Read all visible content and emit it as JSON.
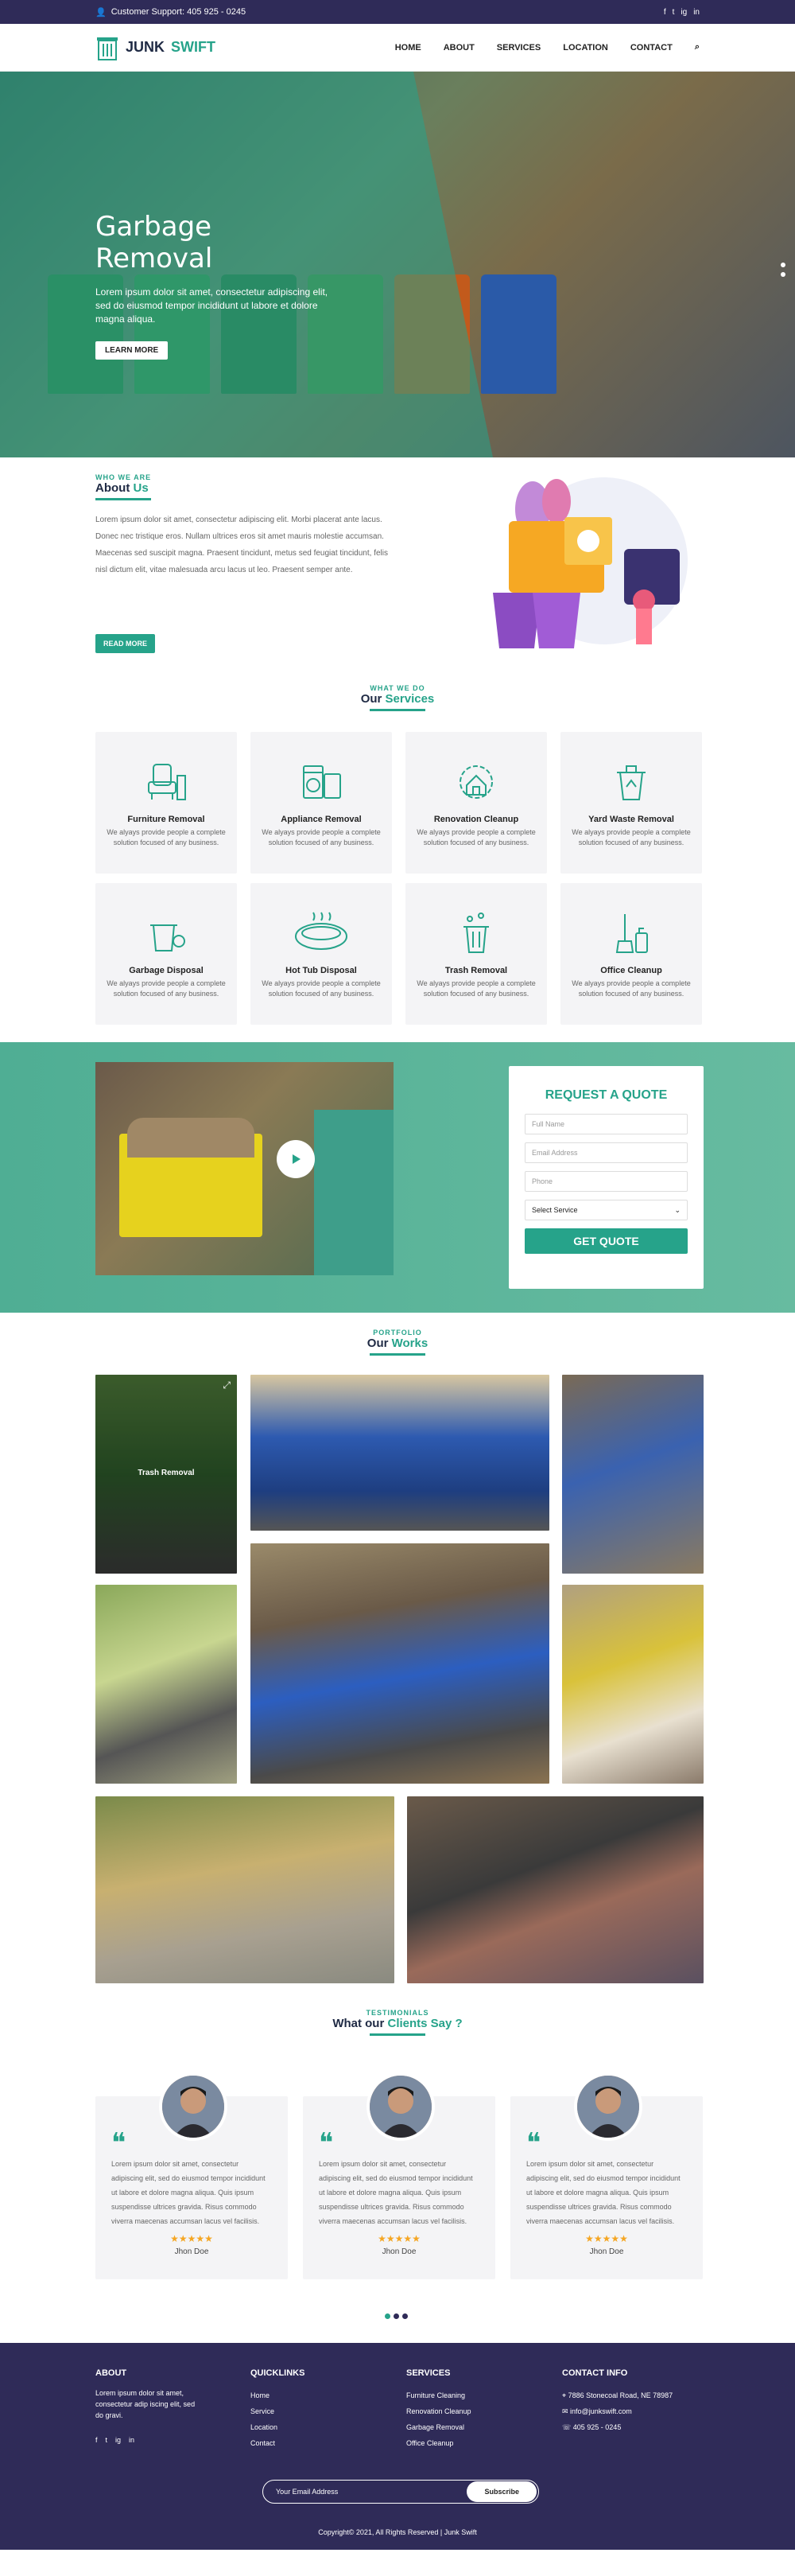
{
  "topbar": {
    "support": "Customer Support: 405 925 - 0245",
    "social": [
      "f",
      "t",
      "ig",
      "in"
    ]
  },
  "nav": {
    "brand_a": "JUNK",
    "brand_b": "SWIFT",
    "items": [
      "HOME",
      "ABOUT",
      "SERVICES",
      "LOCATION",
      "CONTACT"
    ]
  },
  "hero": {
    "title": "Garbage Removal",
    "text": "Lorem ipsum dolor sit amet, consectetur adipiscing elit, sed do eiusmod tempor incididunt ut labore et dolore magna aliqua.",
    "cta": "LEARN MORE"
  },
  "about": {
    "eyebrow": "WHO WE ARE",
    "title_a": "About",
    "title_b": "Us",
    "text": "Lorem ipsum dolor sit amet, consectetur adipiscing elit. Morbi placerat ante lacus. Donec nec tristique eros. Nullam ultrices eros sit amet mauris molestie accumsan. Maecenas sed suscipit magna. Praesent tincidunt, metus sed feugiat tincidunt, felis nisl dictum elit, vitae malesuada arcu lacus ut leo. Praesent semper ante.",
    "cta": "READ MORE"
  },
  "services": {
    "eyebrow": "WHAT WE DO",
    "title_a": "Our",
    "title_b": "Services",
    "items": [
      {
        "title": "Furniture Removal",
        "desc": "We alyays provide people a complete solution focused of any business.",
        "icon": "chair-icon"
      },
      {
        "title": "Appliance Removal",
        "desc": "We alyays provide people a complete solution focused of any business.",
        "icon": "washer-icon"
      },
      {
        "title": "Renovation Cleanup",
        "desc": "We alyays provide people a complete solution focused of any business.",
        "icon": "house-gear-icon"
      },
      {
        "title": "Yard Waste Removal",
        "desc": "We alyays provide people a complete solution focused of any business.",
        "icon": "recycle-bin-icon"
      },
      {
        "title": "Garbage Disposal",
        "desc": "We alyays provide people a complete solution focused of any business.",
        "icon": "garbage-bin-icon"
      },
      {
        "title": "Hot Tub Disposal",
        "desc": "We alyays provide people a complete solution focused of any business.",
        "icon": "hot-tub-icon"
      },
      {
        "title": "Trash Removal",
        "desc": "We alyays provide people a complete solution focused of any business.",
        "icon": "trash-can-icon"
      },
      {
        "title": "Office Cleanup",
        "desc": "We alyays provide people a complete solution focused of any business.",
        "icon": "cleaning-icon"
      }
    ]
  },
  "quote": {
    "title": "REQUEST A QUOTE",
    "fields": [
      "Full Name",
      "Email Address",
      "Phone"
    ],
    "select": "Select Service",
    "submit": "GET QUOTE"
  },
  "works": {
    "eyebrow": "PORTFOLIO",
    "title_a": "Our",
    "title_b": "Works",
    "caption": "Trash Removal"
  },
  "testimonials": {
    "eyebrow": "TESTIMONIALS",
    "title_a": "What our",
    "title_b": "Clients Say ?",
    "items": [
      {
        "text": "Lorem ipsum dolor sit amet, consectetur adipiscing elit, sed do eiusmod tempor incididunt ut labore et dolore magna aliqua. Quis ipsum suspendisse ultrices gravida. Risus commodo viverra maecenas accumsan lacus vel facilisis.",
        "name": "Jhon Doe",
        "stars": "★★★★★"
      },
      {
        "text": "Lorem ipsum dolor sit amet, consectetur adipiscing elit, sed do eiusmod tempor incididunt ut labore et dolore magna aliqua. Quis ipsum suspendisse ultrices gravida. Risus commodo viverra maecenas accumsan lacus vel facilisis.",
        "name": "Jhon Doe",
        "stars": "★★★★★"
      },
      {
        "text": "Lorem ipsum dolor sit amet, consectetur adipiscing elit, sed do eiusmod tempor incididunt ut labore et dolore magna aliqua. Quis ipsum suspendisse ultrices gravida. Risus commodo viverra maecenas accumsan lacus vel facilisis.",
        "name": "Jhon Doe",
        "stars": "★★★★★"
      }
    ]
  },
  "footer": {
    "about_h": "ABOUT",
    "about_t": "Lorem ipsum dolor sit amet, consectetur adip iscing elit, sed do gravi.",
    "quick_h": "QUICKLINKS",
    "quick": [
      "Home",
      "Service",
      "Location",
      "Contact"
    ],
    "svc_h": "SERVICES",
    "svc": [
      "Furniture Cleaning",
      "Renovation Cleanup",
      "Garbage Removal",
      "Office Cleanup"
    ],
    "contact_h": "CONTACT INFO",
    "addr": "7886 Stonecoal Road, NE 78987",
    "email": "info@junkswift.com",
    "phone": "405 925 - 0245",
    "email_ph": "Your Email Address",
    "subscribe": "Subscribe",
    "copy": "Copyright© 2021, All Rights Reserved | Junk Swift"
  },
  "colors": {
    "accent": "#26a38a",
    "dark": "#2f2b58"
  }
}
